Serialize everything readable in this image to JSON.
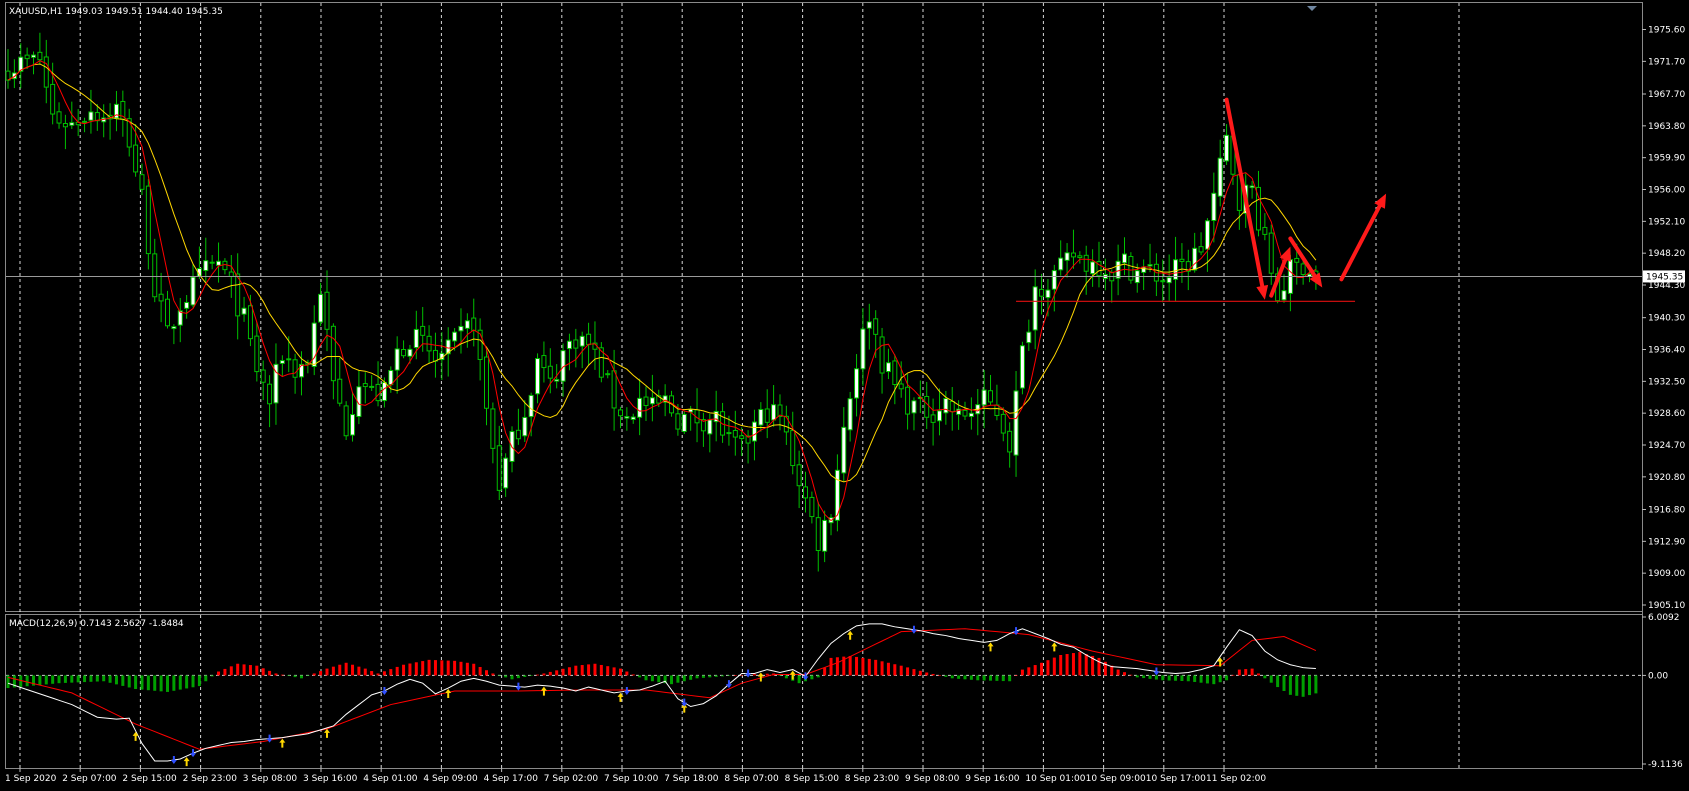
{
  "header": {
    "main_label": "XAUUSD,H1  1949.03 1949.51 1944.40 1945.35",
    "indicator_label": "MACD(12,26,9) 0.7143 2.5627 -1.8484"
  },
  "colors": {
    "background": "#000000",
    "grid": "#ffffff",
    "bull_candle": "#ffffff",
    "bear_candle": "#000000",
    "candle_wick": "#00c000",
    "ma_fast": "#ff0000",
    "ma_slow": "#ffd700",
    "macd_line": "#ffffff",
    "signal_line": "#ff0000",
    "hist_positive": "#ff0000",
    "hist_negative": "#00a000",
    "annotation": "#ff1a1a",
    "up_marker": "#ffd700",
    "down_marker": "#3050ff"
  },
  "chart_data": [
    {
      "type": "candlestick",
      "symbol": "XAUUSD",
      "timeframe": "H1",
      "ylim": [
        1905.1,
        1977.5
      ],
      "y_ticks": [
        "1975.60",
        "1971.70",
        "1967.70",
        "1963.80",
        "1959.90",
        "1956.00",
        "1952.10",
        "1948.20",
        "1944.30",
        "1940.30",
        "1936.40",
        "1932.50",
        "1928.60",
        "1924.70",
        "1920.80",
        "1916.80",
        "1912.90",
        "1909.00",
        "1905.10"
      ],
      "current_price": "1945.35",
      "current_price_value": 1945.35,
      "support_level": 1942.3,
      "x_labels": [
        "1 Sep 2020",
        "2 Sep 07:00",
        "2 Sep 15:00",
        "2 Sep 23:00",
        "3 Sep 08:00",
        "3 Sep 16:00",
        "4 Sep 01:00",
        "4 Sep 09:00",
        "4 Sep 17:00",
        "7 Sep 02:00",
        "7 Sep 10:00",
        "7 Sep 18:00",
        "8 Sep 07:00",
        "8 Sep 15:00",
        "8 Sep 23:00",
        "9 Sep 08:00",
        "9 Sep 16:00",
        "10 Sep 01:00",
        "10 Sep 09:00",
        "10 Sep 17:00",
        "11 Sep 02:00"
      ],
      "anchors": [
        [
          0,
          1971
        ],
        [
          5,
          1972
        ],
        [
          7,
          1965
        ],
        [
          10,
          1964
        ],
        [
          13,
          1966
        ],
        [
          15,
          1965
        ],
        [
          17,
          1966
        ],
        [
          19,
          1962
        ],
        [
          21,
          1955
        ],
        [
          23,
          1944
        ],
        [
          25,
          1938
        ],
        [
          27,
          1942
        ],
        [
          29,
          1944
        ],
        [
          31,
          1946
        ],
        [
          33,
          1947
        ],
        [
          35,
          1944
        ],
        [
          37,
          1940
        ],
        [
          39,
          1934
        ],
        [
          41,
          1930
        ],
        [
          43,
          1936
        ],
        [
          45,
          1934
        ],
        [
          47,
          1935
        ],
        [
          49,
          1944
        ],
        [
          51,
          1932
        ],
        [
          53,
          1927
        ],
        [
          55,
          1933
        ],
        [
          57,
          1931
        ],
        [
          59,
          1931
        ],
        [
          61,
          1936
        ],
        [
          63,
          1938
        ],
        [
          65,
          1937
        ],
        [
          67,
          1935
        ],
        [
          69,
          1936
        ],
        [
          71,
          1938
        ],
        [
          73,
          1940
        ],
        [
          75,
          1929
        ],
        [
          77,
          1920
        ],
        [
          79,
          1925
        ],
        [
          81,
          1929
        ],
        [
          83,
          1935
        ],
        [
          85,
          1932
        ],
        [
          87,
          1936
        ],
        [
          89,
          1938
        ],
        [
          91,
          1937
        ],
        [
          93,
          1934
        ],
        [
          95,
          1930
        ],
        [
          97,
          1928
        ],
        [
          99,
          1930
        ],
        [
          101,
          1929
        ],
        [
          103,
          1930
        ],
        [
          105,
          1928
        ],
        [
          107,
          1928
        ],
        [
          109,
          1928
        ],
        [
          111,
          1928
        ],
        [
          113,
          1925
        ],
        [
          115,
          1924
        ],
        [
          117,
          1927
        ],
        [
          119,
          1929
        ],
        [
          121,
          1928
        ],
        [
          123,
          1923
        ],
        [
          125,
          1918
        ],
        [
          127,
          1913
        ],
        [
          129,
          1917
        ],
        [
          131,
          1927
        ],
        [
          133,
          1935
        ],
        [
          135,
          1941
        ],
        [
          137,
          1935
        ],
        [
          139,
          1932
        ],
        [
          141,
          1930
        ],
        [
          143,
          1929
        ],
        [
          145,
          1929
        ],
        [
          147,
          1930
        ],
        [
          149,
          1928
        ],
        [
          151,
          1929
        ],
        [
          153,
          1930
        ],
        [
          155,
          1929
        ],
        [
          157,
          1925
        ],
        [
          159,
          1936
        ],
        [
          161,
          1944
        ],
        [
          163,
          1945
        ],
        [
          165,
          1946
        ],
        [
          167,
          1948
        ],
        [
          169,
          1947
        ],
        [
          171,
          1947
        ],
        [
          173,
          1946
        ],
        [
          175,
          1947
        ],
        [
          177,
          1946
        ],
        [
          179,
          1946
        ],
        [
          181,
          1945
        ],
        [
          183,
          1946
        ],
        [
          185,
          1947
        ],
        [
          187,
          1949
        ],
        [
          189,
          1955
        ],
        [
          191,
          1962
        ],
        [
          193,
          1955
        ],
        [
          195,
          1956
        ],
        [
          197,
          1949
        ],
        [
          199,
          1943
        ],
        [
          201,
          1946
        ],
        [
          203,
          1947
        ],
        [
          205,
          1945.35
        ]
      ],
      "annotation_arrows": [
        {
          "from": [
            191,
            1967
          ],
          "to": [
            197,
            1942.5
          ]
        },
        {
          "from": [
            198,
            1943
          ],
          "to": [
            201,
            1949
          ]
        },
        {
          "from": [
            201,
            1950
          ],
          "to": [
            206,
            1944
          ]
        },
        {
          "from": [
            209,
            1945
          ],
          "to": [
            216,
            1955.5
          ]
        }
      ]
    },
    {
      "type": "macd",
      "title": "MACD(12,26,9) 0.7143 2.5627 -1.8484",
      "ylim": [
        -9.1136,
        6.0092
      ],
      "y_ticks": [
        "6.0092",
        "0.00",
        "-9.1136"
      ],
      "macd_anchors": [
        [
          0,
          -0.8
        ],
        [
          10,
          -3
        ],
        [
          14,
          -4.3
        ],
        [
          17,
          -4.5
        ],
        [
          19,
          -4.4
        ],
        [
          21,
          -7
        ],
        [
          23,
          -8.8
        ],
        [
          25,
          -8.8
        ],
        [
          27,
          -8.6
        ],
        [
          29,
          -8
        ],
        [
          31,
          -7.5
        ],
        [
          33,
          -7.2
        ],
        [
          35,
          -6.9
        ],
        [
          37,
          -6.8
        ],
        [
          39,
          -6.6
        ],
        [
          41,
          -6.5
        ],
        [
          43,
          -6.4
        ],
        [
          45,
          -6.2
        ],
        [
          47,
          -6
        ],
        [
          49,
          -5.6
        ],
        [
          51,
          -5.2
        ],
        [
          53,
          -4
        ],
        [
          55,
          -3
        ],
        [
          57,
          -2
        ],
        [
          59,
          -1.6
        ],
        [
          61,
          -0.9
        ],
        [
          63,
          -0.4
        ],
        [
          65,
          -0.8
        ],
        [
          67,
          -1.9
        ],
        [
          69,
          -1.3
        ],
        [
          71,
          -0.6
        ],
        [
          73,
          -0.3
        ],
        [
          75,
          -0.6
        ],
        [
          77,
          -1.0
        ],
        [
          79,
          -1.1
        ],
        [
          81,
          -1.2
        ],
        [
          83,
          -1.0
        ],
        [
          85,
          -1.1
        ],
        [
          87,
          -1.3
        ],
        [
          89,
          -1.6
        ],
        [
          91,
          -1.2
        ],
        [
          93,
          -1.5
        ],
        [
          95,
          -1.8
        ],
        [
          97,
          -1.6
        ],
        [
          99,
          -1.5
        ],
        [
          101,
          -1.1
        ],
        [
          103,
          -0.6
        ],
        [
          105,
          -2.4
        ],
        [
          107,
          -3.2
        ],
        [
          109,
          -2.9
        ],
        [
          111,
          -2.1
        ],
        [
          113,
          -0.9
        ],
        [
          115,
          0.2
        ],
        [
          117,
          0.2
        ],
        [
          119,
          0.6
        ],
        [
          121,
          0.3
        ],
        [
          123,
          0.6
        ],
        [
          125,
          -0.1
        ],
        [
          127,
          1.7
        ],
        [
          129,
          3.3
        ],
        [
          131,
          4.3
        ],
        [
          133,
          5.1
        ],
        [
          135,
          5.3
        ],
        [
          137,
          5.3
        ],
        [
          139,
          5.0
        ],
        [
          141,
          4.8
        ],
        [
          143,
          4.6
        ],
        [
          145,
          4.3
        ],
        [
          147,
          4.1
        ],
        [
          149,
          3.8
        ],
        [
          151,
          3.6
        ],
        [
          153,
          3.4
        ],
        [
          155,
          3.6
        ],
        [
          157,
          4.3
        ],
        [
          159,
          4.8
        ],
        [
          161,
          4.3
        ],
        [
          163,
          3.8
        ],
        [
          165,
          3.2
        ],
        [
          167,
          2.9
        ],
        [
          169,
          2.1
        ],
        [
          171,
          1.4
        ],
        [
          173,
          0.9
        ],
        [
          175,
          0.8
        ],
        [
          177,
          0.7
        ],
        [
          179,
          0.5
        ],
        [
          181,
          0.3
        ],
        [
          183,
          0.2
        ],
        [
          185,
          0.3
        ],
        [
          187,
          0.6
        ],
        [
          189,
          1.0
        ],
        [
          191,
          2.9
        ],
        [
          193,
          4.7
        ],
        [
          195,
          4.1
        ],
        [
          197,
          2.5
        ],
        [
          199,
          1.6
        ],
        [
          201,
          1.1
        ],
        [
          203,
          0.8
        ],
        [
          205,
          0.71
        ]
      ],
      "signal_anchors": [
        [
          0,
          -0.2
        ],
        [
          10,
          -1.8
        ],
        [
          20,
          -5
        ],
        [
          30,
          -7.6
        ],
        [
          40,
          -6.8
        ],
        [
          50,
          -5.5
        ],
        [
          60,
          -3
        ],
        [
          70,
          -1.6
        ],
        [
          80,
          -1.6
        ],
        [
          90,
          -1.5
        ],
        [
          100,
          -1.5
        ],
        [
          110,
          -2.3
        ],
        [
          115,
          -0.8
        ],
        [
          120,
          0.1
        ],
        [
          125,
          0.1
        ],
        [
          130,
          1.3
        ],
        [
          140,
          4.5
        ],
        [
          150,
          4.8
        ],
        [
          160,
          4.2
        ],
        [
          170,
          2.5
        ],
        [
          180,
          1.1
        ],
        [
          190,
          1.0
        ],
        [
          195,
          3.6
        ],
        [
          200,
          4.0
        ],
        [
          205,
          2.56
        ]
      ],
      "hist_anchors": [
        [
          0,
          -1.3
        ],
        [
          8,
          -0.8
        ],
        [
          15,
          -0.6
        ],
        [
          20,
          -1.4
        ],
        [
          25,
          -1.7
        ],
        [
          30,
          -1.1
        ],
        [
          33,
          0.4
        ],
        [
          36,
          1.2
        ],
        [
          39,
          1.0
        ],
        [
          42,
          0.2
        ],
        [
          46,
          -0.3
        ],
        [
          50,
          0.7
        ],
        [
          53,
          1.3
        ],
        [
          56,
          0.7
        ],
        [
          58,
          0.2
        ],
        [
          62,
          1.1
        ],
        [
          66,
          1.6
        ],
        [
          70,
          1.5
        ],
        [
          73,
          1.2
        ],
        [
          76,
          0.2
        ],
        [
          79,
          -0.4
        ],
        [
          84,
          0.2
        ],
        [
          89,
          1.0
        ],
        [
          92,
          1.2
        ],
        [
          96,
          0.7
        ],
        [
          100,
          -0.5
        ],
        [
          104,
          -0.9
        ],
        [
          108,
          -0.3
        ],
        [
          112,
          -0.1
        ],
        [
          116,
          0.1
        ],
        [
          120,
          0.2
        ],
        [
          124,
          -0.8
        ],
        [
          127,
          -0.2
        ],
        [
          129,
          1.8
        ],
        [
          132,
          2.0
        ],
        [
          136,
          1.6
        ],
        [
          140,
          1.0
        ],
        [
          144,
          0.3
        ],
        [
          148,
          -0.3
        ],
        [
          152,
          -0.5
        ],
        [
          157,
          -0.6
        ],
        [
          159,
          0.6
        ],
        [
          162,
          1.3
        ],
        [
          165,
          2.1
        ],
        [
          168,
          2.4
        ],
        [
          171,
          1.8
        ],
        [
          174,
          0.6
        ],
        [
          177,
          -0.2
        ],
        [
          181,
          -0.5
        ],
        [
          185,
          -0.6
        ],
        [
          189,
          -0.9
        ],
        [
          191,
          -0.5
        ],
        [
          193,
          0.6
        ],
        [
          195,
          0.7
        ],
        [
          197,
          -0.3
        ],
        [
          199,
          -1.2
        ],
        [
          201,
          -2.0
        ],
        [
          203,
          -2.2
        ],
        [
          205,
          -1.85
        ]
      ],
      "up_arrows": [
        20,
        28,
        43,
        50,
        69,
        84,
        96,
        106,
        118,
        123,
        132,
        154,
        164,
        190
      ],
      "down_arrows": [
        26,
        29,
        41,
        59,
        80,
        97,
        106,
        113,
        116,
        125,
        142,
        158,
        180
      ]
    }
  ]
}
